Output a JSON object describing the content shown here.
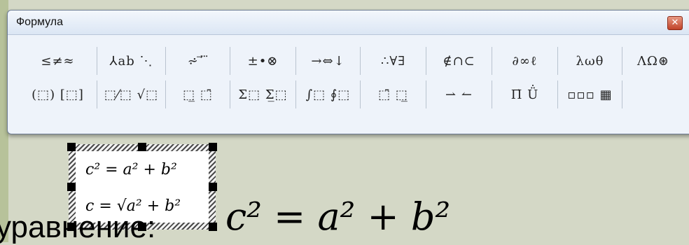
{
  "window": {
    "title": "Формула",
    "close_icon": "close-icon"
  },
  "toolbar": {
    "row1": [
      "≤≠≈",
      "⅄ab ⋱",
      "⩫ ⃗ ⃛",
      "±•⊗",
      "→⇔↓",
      "∴∀∃",
      "∉∩⊂",
      "∂∞ℓ",
      "λωθ",
      "ΛΩ⊛"
    ],
    "row2": [
      "(⬚) [⬚]",
      "⬚⁄⬚ √⬚",
      "⬚̲ ⬚̄",
      "Σ⬚ Σ̲⬚",
      "∫⬚ ∮⬚",
      "⬚̄ ⬚̲",
      "⇀ ↼",
      "Π̇ Ü̇",
      "▫▫▫ ▦",
      ""
    ]
  },
  "equation_object": {
    "line1": "c² = a² + b²",
    "line2": "c = √a² + b²"
  },
  "big_equation": "c² = a² + b²",
  "caption": "уравнение:"
}
